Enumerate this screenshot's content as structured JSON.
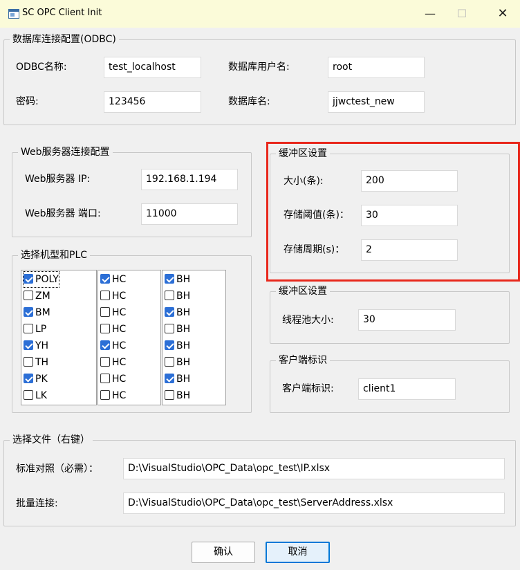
{
  "window": {
    "title": "SC OPC Client Init",
    "minimize_glyph": "—",
    "maximize_glyph": "☐",
    "close_glyph": "✕"
  },
  "odbc": {
    "legend": "数据库连接配置(ODBC)",
    "name_label": "ODBC名称:",
    "name_value": "test_localhost",
    "user_label": "数据库用户名:",
    "user_value": "root",
    "password_label": "密码:",
    "password_value": "123456",
    "db_label": "数据库名:",
    "db_value": "jjwctest_new"
  },
  "web": {
    "legend": "Web服务器连接配置",
    "ip_label": "Web服务器 IP:",
    "ip_value": "192.168.1.194",
    "port_label": "Web服务器 端口:",
    "port_value": "11000"
  },
  "buffer": {
    "legend": "缓冲区设置",
    "size_label": "大小(条):",
    "size_value": "200",
    "threshold_label": "存储阈值(条)：",
    "threshold_value": "30",
    "period_label": "存储周期(s)：",
    "period_value": "2"
  },
  "threadpool": {
    "legend": "缓冲区设置",
    "size_label": "线程池大小:",
    "size_value": "30"
  },
  "client": {
    "legend": "客户端标识",
    "id_label": "客户端标识:",
    "id_value": "client1"
  },
  "plc": {
    "legend": "选择机型和PLC",
    "list1": [
      {
        "label": "POLY",
        "checked": true
      },
      {
        "label": "ZM",
        "checked": false
      },
      {
        "label": "BM",
        "checked": true
      },
      {
        "label": "LP",
        "checked": false
      },
      {
        "label": "YH",
        "checked": true
      },
      {
        "label": "TH",
        "checked": false
      },
      {
        "label": "PK",
        "checked": true
      },
      {
        "label": "LK",
        "checked": false
      }
    ],
    "list2": [
      {
        "label": "HC",
        "checked": true
      },
      {
        "label": "HC",
        "checked": false
      },
      {
        "label": "HC",
        "checked": false
      },
      {
        "label": "HC",
        "checked": false
      },
      {
        "label": "HC",
        "checked": true
      },
      {
        "label": "HC",
        "checked": false
      },
      {
        "label": "HC",
        "checked": false
      },
      {
        "label": "HC",
        "checked": false
      }
    ],
    "list3": [
      {
        "label": "BH",
        "checked": true
      },
      {
        "label": "BH",
        "checked": false
      },
      {
        "label": "BH",
        "checked": true
      },
      {
        "label": "BH",
        "checked": false
      },
      {
        "label": "BH",
        "checked": true
      },
      {
        "label": "BH",
        "checked": false
      },
      {
        "label": "BH",
        "checked": true
      },
      {
        "label": "BH",
        "checked": false
      }
    ]
  },
  "files": {
    "legend": "选择文件（右键）",
    "standard_label": "标准对照（必需）：",
    "standard_value": "D:\\VisualStudio\\OPC_Data\\opc_test\\IP.xlsx",
    "batch_label": "批量连接:",
    "batch_value": "D:\\VisualStudio\\OPC_Data\\opc_test\\ServerAddress.xlsx"
  },
  "buttons": {
    "confirm": "确认",
    "cancel": "取消"
  },
  "colors": {
    "highlight_border": "#e8271b",
    "checkbox_checked": "#2c6fd6",
    "titlebar": "#fbfbd9"
  }
}
